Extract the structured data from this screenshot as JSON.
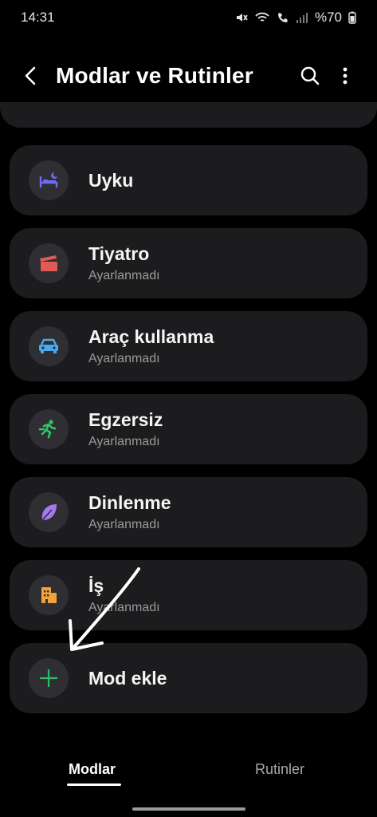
{
  "status_bar": {
    "time": "14:31",
    "battery": "%70",
    "icons": [
      "mute-icon",
      "wifi-call-icon",
      "call-icon",
      "signal-icon",
      "battery-icon"
    ]
  },
  "app_bar": {
    "title": "Modlar ve Rutinler",
    "icons": [
      "back-arrow-icon",
      "search-icon",
      "more-vert-icon"
    ]
  },
  "modes": [
    {
      "name": "Uyku",
      "status": "",
      "icon": "bed-icon",
      "color": "#6f6cf5"
    },
    {
      "name": "Tiyatro",
      "status": "Ayarlanmadı",
      "icon": "clapperboard-icon",
      "color": "#e05a56"
    },
    {
      "name": "Araç kullanma",
      "status": "Ayarlanmadı",
      "icon": "car-icon",
      "color": "#4aa8f0"
    },
    {
      "name": "Egzersiz",
      "status": "Ayarlanmadı",
      "icon": "running-icon",
      "color": "#33c26b"
    },
    {
      "name": "Dinlenme",
      "status": "Ayarlanmadı",
      "icon": "leaf-icon",
      "color": "#a678f2"
    },
    {
      "name": "İş",
      "status": "Ayarlanmadı",
      "icon": "building-icon",
      "color": "#f2a23a"
    }
  ],
  "add_mode": {
    "label": "Mod ekle",
    "icon": "plus-icon",
    "color": "#2fbd6b"
  },
  "bottom_nav": {
    "tabs": [
      {
        "label": "Modlar",
        "active": true
      },
      {
        "label": "Rutinler",
        "active": false
      }
    ]
  }
}
